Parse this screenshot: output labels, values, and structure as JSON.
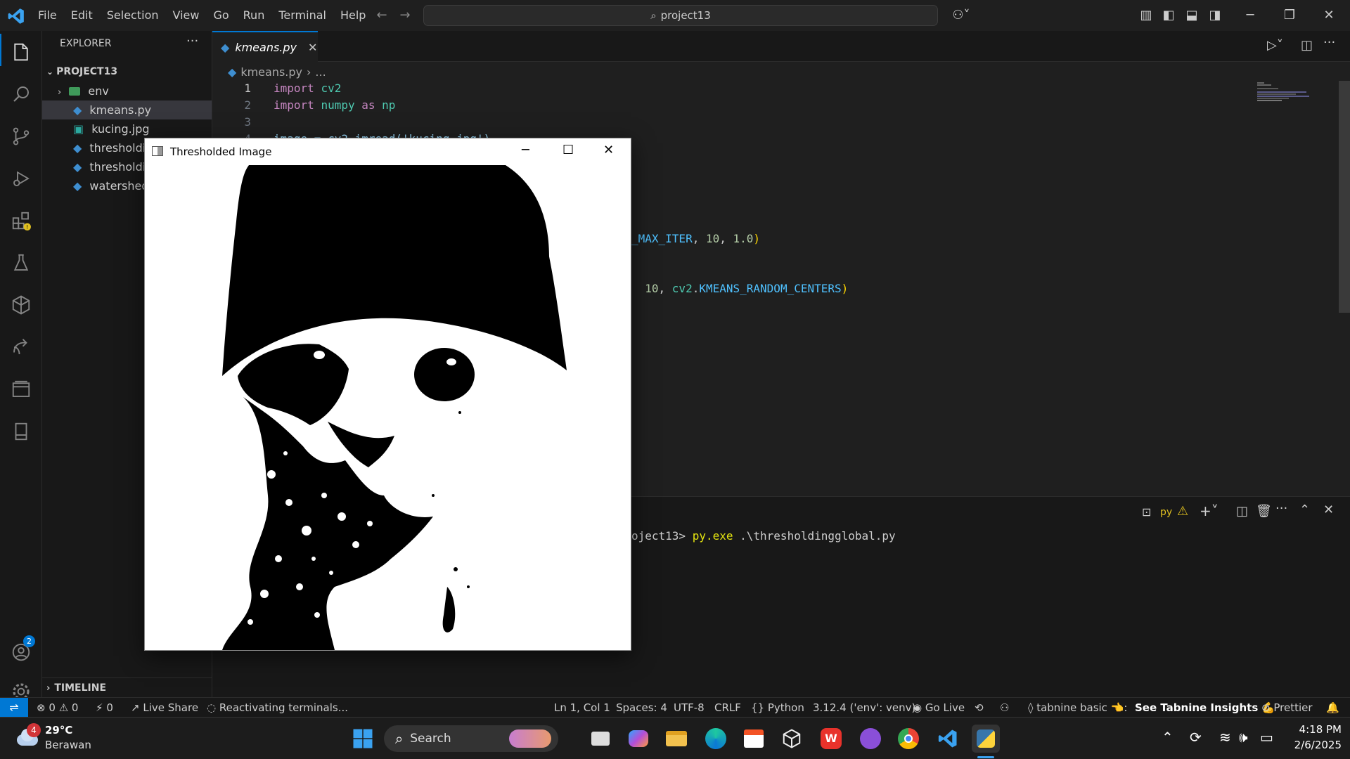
{
  "titlebar": {
    "menu": [
      "File",
      "Edit",
      "Selection",
      "View",
      "Go",
      "Run",
      "Terminal",
      "Help"
    ],
    "search_text": "project13"
  },
  "explorer": {
    "header": "EXPLORER",
    "project": "PROJECT13",
    "items": [
      "env",
      "kmeans.py",
      "kucing.jpg",
      "thresholdi",
      "thresholdi",
      "watershed"
    ],
    "timeline": "TIMELINE"
  },
  "editor": {
    "tab": "kmeans.py",
    "breadcrumb_file": "kmeans.py",
    "breadcrumb_rest": "...",
    "line_numbers": [
      "1",
      "2",
      "3",
      "4"
    ],
    "line1": {
      "kw": "import",
      "mod": "cv2"
    },
    "line2": {
      "kw": "import",
      "mod": "numpy",
      "as": "as",
      "alias": "np"
    },
    "line4_partial": "image = cv2.imread('kucing.jpg')",
    "frag_a": {
      "text1": "_MAX_ITER",
      "sep": ", ",
      "num1": "10",
      "sep2": ", ",
      "num2": "1.0",
      "close": ")"
    },
    "frag_b": {
      "num": "10",
      "sep": ", ",
      "mod": "cv2",
      "dot": ".",
      "const": "KMEANS_RANDOM_CENTERS",
      "close": ")"
    }
  },
  "terminal": {
    "shell_label": "py",
    "prompt_tail": "oject13>",
    "cmd": "py.exe",
    "arg": " .\\thresholdingglobal.py"
  },
  "cv_window": {
    "title": "Thresholded Image"
  },
  "statusbar": {
    "errors": "0",
    "warnings": "0",
    "ports": "0",
    "live_share": "Live Share",
    "reactivating": "Reactivating terminals...",
    "position": "Ln 1, Col 1",
    "spaces": "Spaces: 4",
    "encoding": "UTF-8",
    "eol": "CRLF",
    "language": "Python",
    "interpreter": "3.12.4 ('env': venv)",
    "go_live": "Go Live",
    "tabnine": "tabnine basic 👈:",
    "tabnine_insights": "See Tabnine Insights 💪",
    "prettier": "Prettier"
  },
  "activity_badge": "2",
  "taskbar": {
    "weather_temp": "29°C",
    "weather_desc": "Berawan",
    "weather_badge": "4",
    "search": "Search",
    "time": "4:18 PM",
    "date": "2/6/2025"
  },
  "colors": {
    "accent": "#0078d4",
    "keyword": "#c586c0",
    "module": "#4ec9b0",
    "number": "#b5cea8"
  }
}
